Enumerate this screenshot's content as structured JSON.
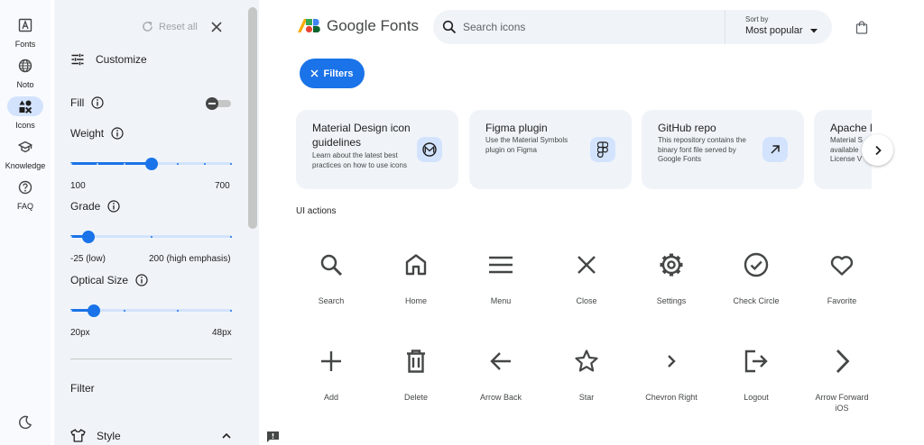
{
  "rail": {
    "items": [
      {
        "label": "Fonts",
        "icon": "font-icon"
      },
      {
        "label": "Noto",
        "icon": "globe-icon"
      },
      {
        "label": "Icons",
        "icon": "icons-shapes-icon",
        "active": true
      },
      {
        "label": "Knowledge",
        "icon": "school-icon"
      },
      {
        "label": "FAQ",
        "icon": "help-icon"
      }
    ]
  },
  "panel": {
    "reset_label": "Reset all",
    "title": "Customize",
    "fill_label": "Fill",
    "weight": {
      "label": "Weight",
      "min": "100",
      "max": "700",
      "value": 400,
      "range": [
        100,
        700
      ]
    },
    "grade": {
      "label": "Grade",
      "min": "-25 (low)",
      "max": "200 (high emphasis)",
      "value": 0,
      "range": [
        -25,
        200
      ]
    },
    "optical": {
      "label": "Optical Size",
      "min": "20px",
      "max": "48px",
      "value": 24,
      "range": [
        20,
        48
      ]
    },
    "filter_label": "Filter",
    "style_label": "Style"
  },
  "header": {
    "logo_text": "Google Fonts",
    "search_placeholder": "Search icons",
    "sort_label": "Sort by",
    "sort_value": "Most popular"
  },
  "filters_label": "Filters",
  "cards": [
    {
      "title": "Material Design icon guidelines",
      "desc": "Learn about the latest best practices on how to use icons"
    },
    {
      "title": "Figma plugin",
      "desc": "Use the Material Symbols plugin on Figma"
    },
    {
      "title": "GitHub repo",
      "desc": "This repository contains the binary font file served by Google Fonts"
    },
    {
      "title": "Apache l",
      "desc": "Material S available License V"
    }
  ],
  "section_title": "UI actions",
  "icons": [
    {
      "label": "Search"
    },
    {
      "label": "Home"
    },
    {
      "label": "Menu"
    },
    {
      "label": "Close"
    },
    {
      "label": "Settings"
    },
    {
      "label": "Check Circle"
    },
    {
      "label": "Favorite"
    },
    {
      "label": "Add"
    },
    {
      "label": "Delete"
    },
    {
      "label": "Arrow Back"
    },
    {
      "label": "Star"
    },
    {
      "label": "Chevron Right"
    },
    {
      "label": "Logout"
    },
    {
      "label": "Arrow Forward iOS"
    }
  ],
  "colors": {
    "accent": "#1a73e8",
    "panel_bg": "#f0f4f9",
    "icon": "#444746"
  }
}
